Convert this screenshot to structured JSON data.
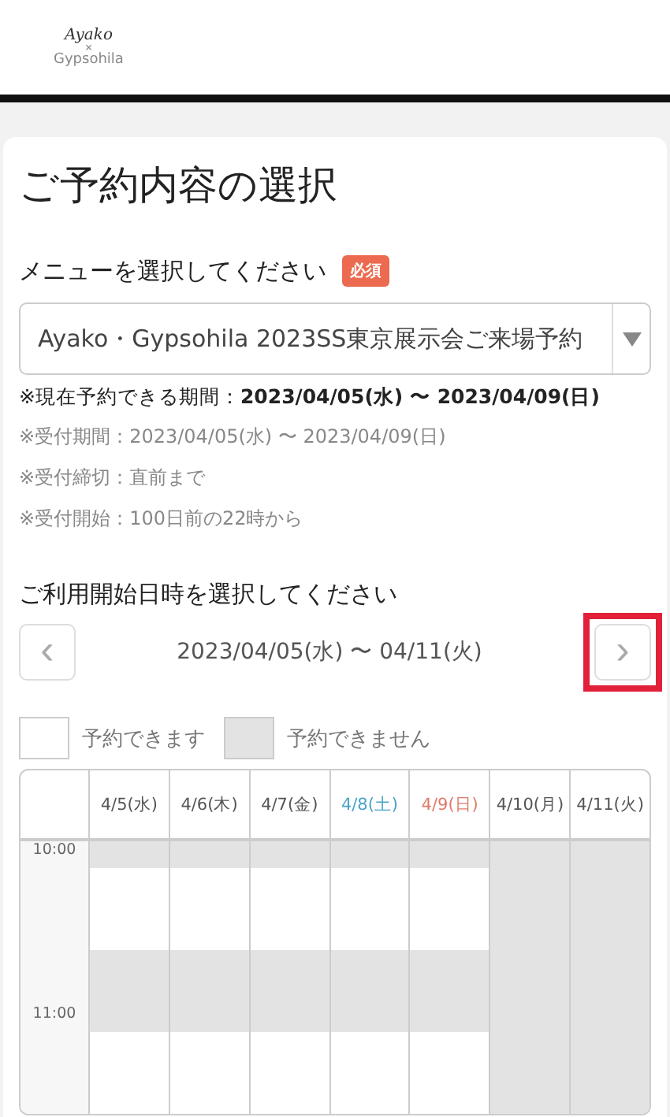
{
  "header": {
    "logo_top": "Ayako",
    "logo_mid": "×",
    "logo_bottom": "Gypsohila"
  },
  "page_title": "ご予約内容の選択",
  "menu": {
    "label": "メニューを選択してください",
    "badge": "必須",
    "value": "Ayako・Gypsohila 2023SS東京展示会ご来場予約",
    "notes": [
      {
        "kind": "strong",
        "label": "※現在予約できる期間：",
        "value": "2023/04/05(水) 〜 2023/04/09(日)"
      },
      {
        "kind": "plain",
        "label": "※受付期間：",
        "value": "2023/04/05(水) 〜 2023/04/09(日)"
      },
      {
        "kind": "plain",
        "label": "※受付締切：",
        "value": "直前まで"
      },
      {
        "kind": "plain",
        "label": "※受付開始：",
        "value": "100日前の22時から"
      }
    ]
  },
  "date_picker": {
    "label": "ご利用開始日時を選択してください",
    "range": "2023/04/05(水) 〜 04/11(火)",
    "prev": {
      "glyph": "‹"
    },
    "next": {
      "glyph": "›",
      "highlighted": true
    }
  },
  "legend": [
    {
      "kind": "available",
      "label": "予約できます"
    },
    {
      "kind": "unavailable",
      "label": "予約できません"
    }
  ],
  "schedule": {
    "days": [
      {
        "label": "4/5(水)",
        "kind": "weekday"
      },
      {
        "label": "4/6(木)",
        "kind": "weekday"
      },
      {
        "label": "4/7(金)",
        "kind": "weekday"
      },
      {
        "label": "4/8(土)",
        "kind": "saturday"
      },
      {
        "label": "4/9(日)",
        "kind": "sunday"
      },
      {
        "label": "4/10(月)",
        "kind": "weekday"
      },
      {
        "label": "4/11(火)",
        "kind": "weekday"
      }
    ],
    "rows": [
      {
        "time": "10:00",
        "slots": [
          {
            "available": false
          },
          {
            "available": false
          },
          {
            "available": false
          },
          {
            "available": false
          },
          {
            "available": false
          },
          {
            "available": false
          },
          {
            "available": false
          }
        ]
      },
      {
        "slots": [
          {
            "available": true
          },
          {
            "available": true
          },
          {
            "available": true
          },
          {
            "available": true
          },
          {
            "available": true
          },
          {
            "available": false
          },
          {
            "available": false
          }
        ]
      },
      {
        "slots": [
          {
            "available": true
          },
          {
            "available": true
          },
          {
            "available": true
          },
          {
            "available": true
          },
          {
            "available": true
          },
          {
            "available": false
          },
          {
            "available": false
          }
        ]
      },
      {
        "slots": [
          {
            "available": true
          },
          {
            "available": true
          },
          {
            "available": true
          },
          {
            "available": true
          },
          {
            "available": true
          },
          {
            "available": false
          },
          {
            "available": false
          }
        ]
      },
      {
        "slots": [
          {
            "available": false
          },
          {
            "available": false
          },
          {
            "available": false
          },
          {
            "available": false
          },
          {
            "available": false
          },
          {
            "available": false
          },
          {
            "available": false
          }
        ]
      },
      {
        "slots": [
          {
            "available": false
          },
          {
            "available": false
          },
          {
            "available": false
          },
          {
            "available": false
          },
          {
            "available": false
          },
          {
            "available": false
          },
          {
            "available": false
          }
        ]
      },
      {
        "time": "11:00",
        "slots": [
          {
            "available": false
          },
          {
            "available": false
          },
          {
            "available": false
          },
          {
            "available": false
          },
          {
            "available": false
          },
          {
            "available": false
          },
          {
            "available": false
          }
        ]
      },
      {
        "slots": [
          {
            "available": true
          },
          {
            "available": true
          },
          {
            "available": true
          },
          {
            "available": true
          },
          {
            "available": true
          },
          {
            "available": false
          },
          {
            "available": false
          }
        ]
      },
      {
        "slots": [
          {
            "available": true
          },
          {
            "available": true
          },
          {
            "available": true
          },
          {
            "available": true
          },
          {
            "available": true
          },
          {
            "available": false
          },
          {
            "available": false
          }
        ]
      },
      {
        "slots": [
          {
            "available": true
          },
          {
            "available": true
          },
          {
            "available": true
          },
          {
            "available": true
          },
          {
            "available": true
          },
          {
            "available": false
          },
          {
            "available": false
          }
        ]
      }
    ]
  }
}
